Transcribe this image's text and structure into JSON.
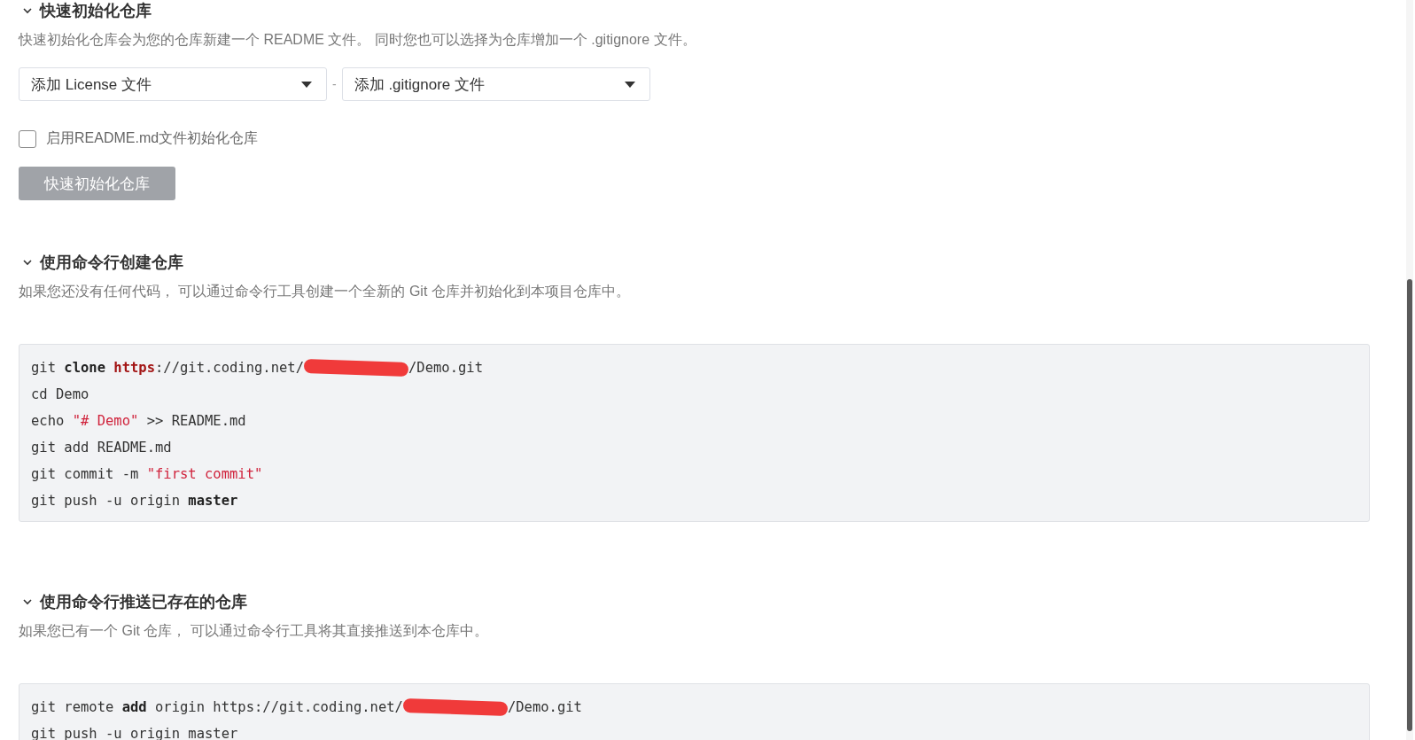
{
  "sections": [
    {
      "kind": "quick_init",
      "title": "快速初始化仓库",
      "expanded": true,
      "description": "快速初始化仓库会为您的仓库新建一个 README 文件。 同时您也可以选择为仓库增加一个 .gitignore 文件。",
      "selects": [
        {
          "value": "添加 License 文件"
        },
        {
          "value": "添加 .gitignore 文件"
        }
      ],
      "separator": "-",
      "checkbox": {
        "label": "启用README.md文件初始化仓库",
        "checked": false
      },
      "button": {
        "label": "快速初始化仓库",
        "disabled": true
      }
    },
    {
      "kind": "code",
      "title": "使用命令行创建仓库",
      "expanded": true,
      "description": "如果您还没有任何代码， 可以通过命令行工具创建一个全新的 Git 仓库并初始化到本项目仓库中。",
      "lines": [
        [
          {
            "kind": "plain",
            "text": "git "
          },
          {
            "kind": "keyword",
            "text": "clone "
          },
          {
            "kind": "builtin",
            "text": "https"
          },
          {
            "kind": "plain",
            "text": "://git.coding.net/"
          },
          {
            "kind": "redacted"
          },
          {
            "kind": "plain",
            "text": "/Demo.git"
          }
        ],
        [
          {
            "kind": "plain",
            "text": "cd Demo"
          }
        ],
        [
          {
            "kind": "plain",
            "text": "echo "
          },
          {
            "kind": "string",
            "text": "\"# Demo\""
          },
          {
            "kind": "plain",
            "text": " >> README.md"
          }
        ],
        [
          {
            "kind": "plain",
            "text": "git add README.md"
          }
        ],
        [
          {
            "kind": "plain",
            "text": "git commit -m "
          },
          {
            "kind": "string",
            "text": "\"first commit\""
          }
        ],
        [
          {
            "kind": "plain",
            "text": "git push -u origin "
          },
          {
            "kind": "keyword",
            "text": "master"
          }
        ]
      ]
    },
    {
      "kind": "code",
      "title": "使用命令行推送已存在的仓库",
      "expanded": true,
      "description": "如果您已有一个 Git 仓库， 可以通过命令行工具将其直接推送到本仓库中。",
      "lines": [
        [
          {
            "kind": "plain",
            "text": "git remote "
          },
          {
            "kind": "keyword",
            "text": "add"
          },
          {
            "kind": "plain",
            "text": " origin https://git.coding.net/"
          },
          {
            "kind": "redacted"
          },
          {
            "kind": "plain",
            "text": "/Demo.git"
          }
        ],
        [
          {
            "kind": "plain",
            "text": "git push -u origin master"
          }
        ]
      ]
    }
  ]
}
